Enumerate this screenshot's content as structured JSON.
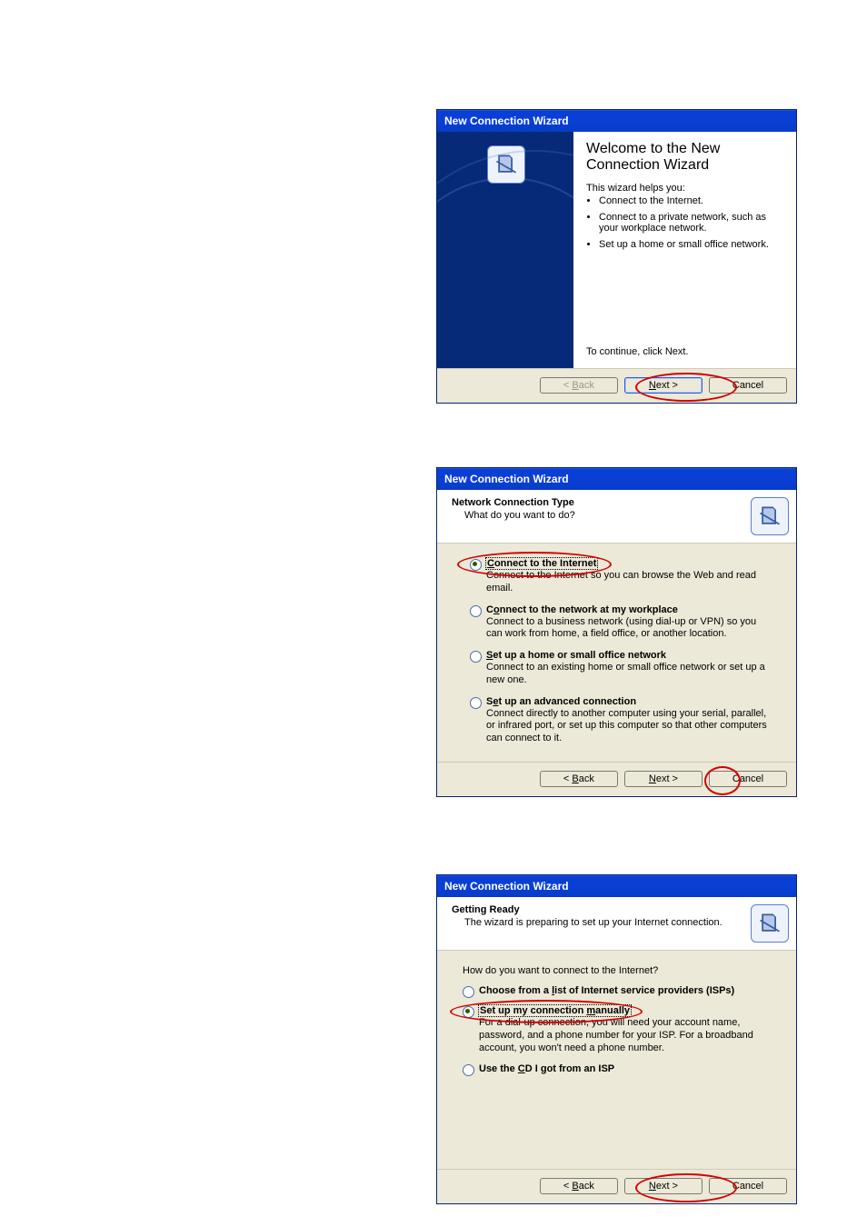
{
  "common": {
    "title": "New Connection Wizard",
    "back": "< Back",
    "next": "Next >",
    "cancel": "Cancel",
    "next_u": "N",
    "back_u": "B"
  },
  "dlg1": {
    "heading": "Welcome to the New Connection Wizard",
    "helps": "This wizard helps you:",
    "b1": "Connect to the Internet.",
    "b2": "Connect to a private network, such as your workplace network.",
    "b3": "Set up a home or small office network.",
    "continue": "To continue, click Next."
  },
  "dlg2": {
    "h1": "Network Connection Type",
    "h2": "What do you want to do?",
    "opt1_label": "Connect to the Internet",
    "opt1_desc": "Connect to the Internet so you can browse the Web and read email.",
    "opt2_label": "Connect to the network at my workplace",
    "opt2_desc": "Connect to a business network (using dial-up or VPN) so you can work from home, a field office, or another location.",
    "opt3_label": "Set up a home or small office network",
    "opt3_desc": "Connect to an existing home or small office network or set up a new one.",
    "opt4_label": "Set up an advanced connection",
    "opt4_desc": "Connect directly to another computer using your serial, parallel, or infrared port, or set up this computer so that other computers can connect to it."
  },
  "dlg3": {
    "h1": "Getting Ready",
    "h2": "The wizard is preparing to set up your Internet connection.",
    "question": "How do you want to connect to the Internet?",
    "opt1_label": "Choose from a list of Internet service providers (ISPs)",
    "opt2_label": "Set up my connection manually",
    "opt2_desc": "For a dial-up connection, you will need your account name, password, and a phone number for your ISP. For a broadband account, you won't need a phone number.",
    "opt3_label": "Use the CD I got from an ISP"
  }
}
